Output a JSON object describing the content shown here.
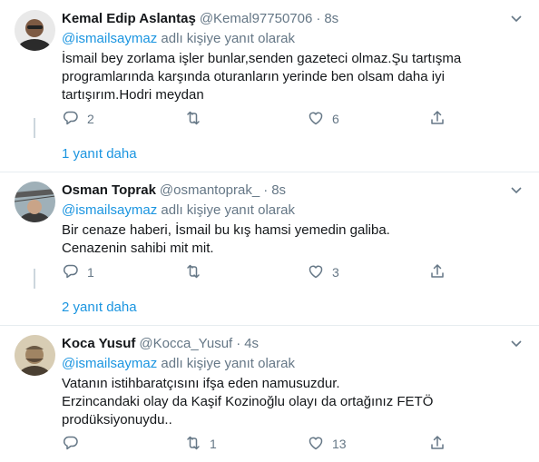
{
  "reply_prefix_mention": "@ismailsaymaz",
  "reply_prefix_text": "adlı kişiye yanıt olarak",
  "tweets": [
    {
      "name": "Kemal Edip Aslantaş",
      "handle": "@Kemal97750706",
      "dot": "·",
      "time": "8s",
      "lines": [
        "İsmail bey zorlama işler bunlar,senden gazeteci olmaz.Şu tartışma",
        "programlarında karşında oturanların yerinde ben olsam daha iyi",
        "tartışırım.Hodri meydan"
      ],
      "replies": "2",
      "retweets": "",
      "likes": "6",
      "more": "1 yanıt daha"
    },
    {
      "name": "Osman Toprak",
      "handle": "@osmantoprak_",
      "dot": "·",
      "time": "8s",
      "lines": [
        "Bir cenaze haberi, İsmail bu kış hamsi yemedin galiba.",
        "Cenazenin sahibi mit mit."
      ],
      "replies": "1",
      "retweets": "",
      "likes": "3",
      "more": "2 yanıt daha"
    },
    {
      "name": "Koca Yusuf",
      "handle": "@Kocca_Yusuf",
      "dot": "·",
      "time": "4s",
      "lines": [
        "Vatanın istihbaratçısını ifşa eden namusuzdur.",
        "Erzincandaki olay da Kaşif Kozinoğlu olayı da ortağınız FETÖ",
        "prodüksiyonuydu.."
      ],
      "replies": "",
      "retweets": "1",
      "likes": "13"
    }
  ],
  "icons": {
    "reply": "reply-icon",
    "retweet": "retweet-icon",
    "like": "heart-icon",
    "share": "share-icon",
    "menu": "chevron-down-icon"
  },
  "colors": {
    "link": "#1b95e0",
    "muted": "#657786",
    "text": "#14171a",
    "divider": "#e6ecf0"
  }
}
